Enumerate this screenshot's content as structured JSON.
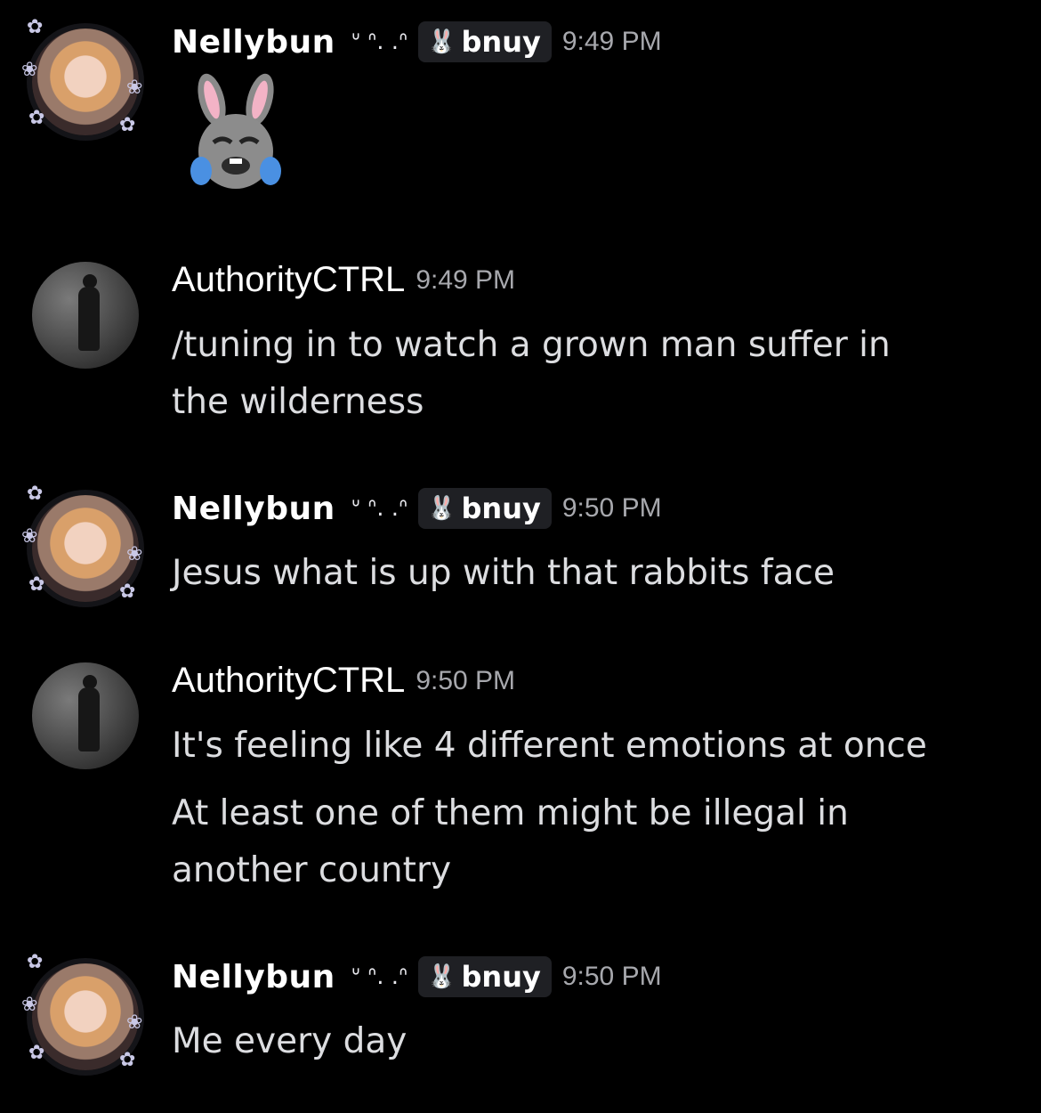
{
  "messages": [
    {
      "author": "Nellybun",
      "decoration": "ᐡ ᐢ. .ᐢ",
      "role_tag": "bnuy",
      "role_icon": "rabbit-face-icon",
      "time": "9:49 PM",
      "emoji": "rabbit-face-crying-laughing"
    },
    {
      "author": "AuthorityCTRL",
      "time": "9:49 PM",
      "lines": [
        "/tuning in to watch a grown man suffer in",
        "the wilderness"
      ]
    },
    {
      "author": "Nellybun",
      "decoration": "ᐡ ᐢ. .ᐢ",
      "role_tag": "bnuy",
      "time": "9:50 PM",
      "lines": [
        "Jesus what is up with that rabbits face"
      ]
    },
    {
      "author": "AuthorityCTRL",
      "time": "9:50 PM",
      "lines": [
        "It's feeling like 4 different emotions at once"
      ],
      "followup": [
        "At least one of them might be illegal in",
        "another country"
      ]
    },
    {
      "author": "Nellybun",
      "decoration": "ᐡ ᐢ. .ᐢ",
      "role_tag": "bnuy",
      "time": "9:50 PM",
      "lines": [
        "Me every day"
      ]
    }
  ]
}
